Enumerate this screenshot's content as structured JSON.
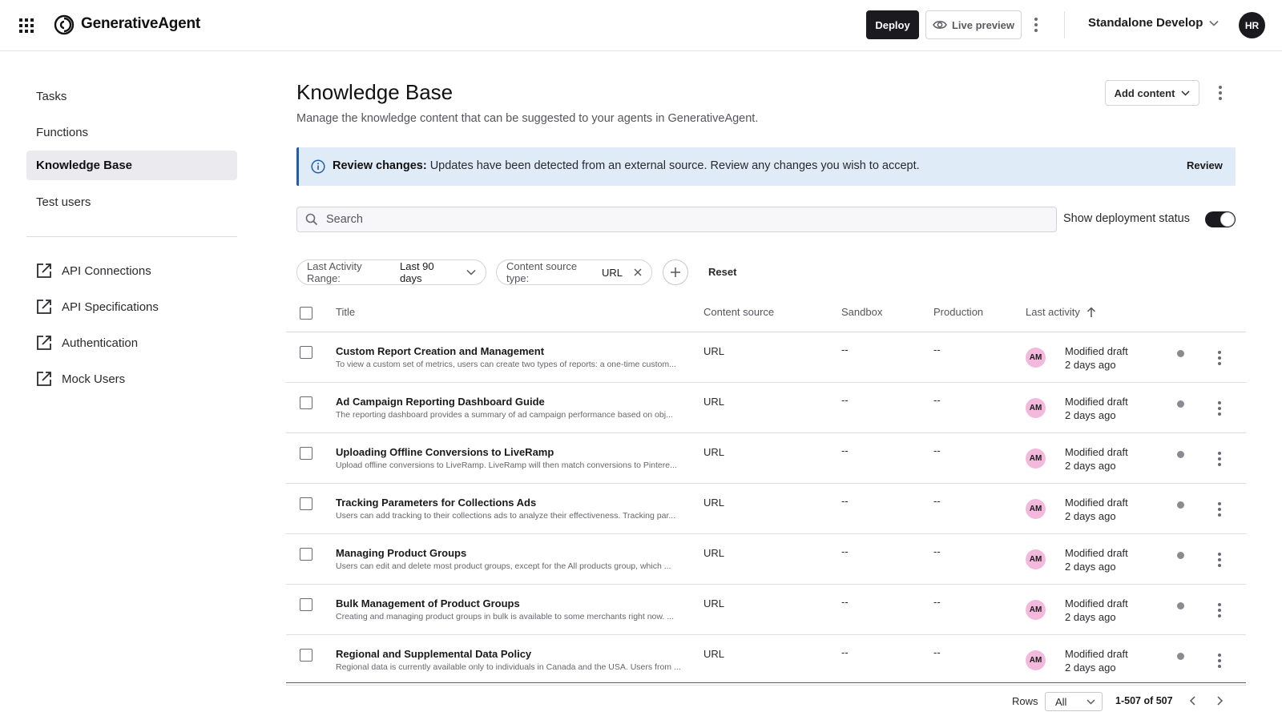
{
  "app": {
    "brand": "GenerativeAgent"
  },
  "header": {
    "deploy_label": "Deploy",
    "live_preview_label": "Live preview",
    "environment": "Standalone Develop",
    "user_initials": "HR"
  },
  "sidebar": {
    "items": [
      {
        "label": "Tasks",
        "active": false
      },
      {
        "label": "Functions",
        "active": false
      },
      {
        "label": "Knowledge Base",
        "active": true
      },
      {
        "label": "Test users",
        "active": false
      }
    ],
    "links": [
      {
        "label": "API Connections",
        "icon": "external-link-icon"
      },
      {
        "label": "API Specifications",
        "icon": "external-link-icon"
      },
      {
        "label": "Authentication",
        "icon": "external-link-icon"
      },
      {
        "label": "Mock Users",
        "icon": "external-link-icon"
      }
    ]
  },
  "main": {
    "title": "Knowledge Base",
    "subtitle": "Manage the knowledge content that can be suggested to your agents in GenerativeAgent.",
    "add_content_label": "Add content",
    "banner": {
      "heading": "Review changes:",
      "text": " Updates have been detected from an external source. Review any changes you wish to accept.",
      "action": "Review"
    },
    "search": {
      "placeholder": "Search",
      "value": ""
    },
    "deployment_toggle": {
      "label": "Show deployment status",
      "on": true
    },
    "filters": [
      {
        "label": "Last Activity Range:",
        "value": "Last 90 days",
        "control": "chevron-down-icon"
      },
      {
        "label": "Content source type:",
        "value": "URL",
        "control": "close-icon"
      }
    ],
    "reset_label": "Reset"
  },
  "table": {
    "columns": [
      "Title",
      "Content source",
      "Sandbox",
      "Production",
      "Last activity"
    ],
    "sort": {
      "column": "Last activity",
      "direction": "ascending"
    },
    "rows": [
      {
        "title": "Custom Report Creation and Management",
        "desc": "To view a custom set of metrics, users can create two types of reports: a one-time custom...",
        "source": "URL",
        "sandbox": "--",
        "production": "--",
        "initials": "AM",
        "activity": "Modified draft",
        "ago": "2 days ago"
      },
      {
        "title": "Ad Campaign Reporting Dashboard Guide",
        "desc": "The reporting dashboard provides a summary of ad campaign performance based on obj...",
        "source": "URL",
        "sandbox": "--",
        "production": "--",
        "initials": "AM",
        "activity": "Modified draft",
        "ago": "2 days ago"
      },
      {
        "title": "Uploading Offline Conversions to LiveRamp",
        "desc": "Upload offline conversions to LiveRamp. LiveRamp will then match conversions to Pintere...",
        "source": "URL",
        "sandbox": "--",
        "production": "--",
        "initials": "AM",
        "activity": "Modified draft",
        "ago": "2 days ago"
      },
      {
        "title": "Tracking Parameters for Collections Ads",
        "desc": "Users can add tracking to their collections ads to analyze their effectiveness. Tracking par...",
        "source": "URL",
        "sandbox": "--",
        "production": "--",
        "initials": "AM",
        "activity": "Modified draft",
        "ago": "2 days ago"
      },
      {
        "title": "Managing Product Groups",
        "desc": "Users can edit and delete most product groups, except for the All products group, which ...",
        "source": "URL",
        "sandbox": "--",
        "production": "--",
        "initials": "AM",
        "activity": "Modified draft",
        "ago": "2 days ago"
      },
      {
        "title": "Bulk Management of Product Groups",
        "desc": "Creating and managing product groups in bulk is available to some merchants right now. ...",
        "source": "URL",
        "sandbox": "--",
        "production": "--",
        "initials": "AM",
        "activity": "Modified draft",
        "ago": "2 days ago"
      },
      {
        "title": "Regional and Supplemental Data Policy",
        "desc": "Regional data is currently available only to individuals in Canada and the USA. Users from ...",
        "source": "URL",
        "sandbox": "--",
        "production": "--",
        "initials": "AM",
        "activity": "Modified draft",
        "ago": "2 days ago"
      }
    ]
  },
  "pagination": {
    "rows_label": "Rows",
    "rows_value": "All",
    "range": "1-507 of 507"
  },
  "colors": {
    "banner_bg": "#e0ebf8",
    "banner_accent": "#1f5fa8",
    "avatar_pink": "#f3b9dc",
    "primary_dark": "#1b1b1f",
    "active_nav_bg": "#ebebef"
  }
}
